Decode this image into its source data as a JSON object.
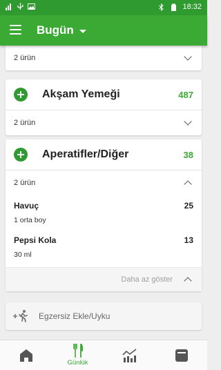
{
  "status_bar": {
    "time": "18:32"
  },
  "app_bar": {
    "title": "Bugün"
  },
  "meals": [
    {
      "item_count_label": "2 ürün"
    },
    {
      "name": "Akşam Yemeği",
      "kcal": "487",
      "item_count_label": "2 ürün"
    },
    {
      "name": "Aperatifler/Diğer",
      "kcal": "38",
      "item_count_label": "2 ürün",
      "foods": [
        {
          "name": "Havuç",
          "kcal": "25",
          "amount": "1 orta boy"
        },
        {
          "name": "Pepsi Kola",
          "kcal": "13",
          "amount": "30 ml"
        }
      ],
      "show_less_label": "Daha az göster"
    }
  ],
  "exercise": {
    "label": "Egzersiz Ekle/Uyku"
  },
  "bottom_nav": [
    {
      "icon": "home-icon",
      "label": ""
    },
    {
      "icon": "fork-knife-icon",
      "label": "Günlük",
      "active": true
    },
    {
      "icon": "progress-chart-icon",
      "label": ""
    },
    {
      "icon": "diary-book-icon",
      "label": ""
    }
  ],
  "colors": {
    "brand": "#3aaa35",
    "status_bar": "#2f9a2f",
    "kcal": "#3aaa35"
  }
}
